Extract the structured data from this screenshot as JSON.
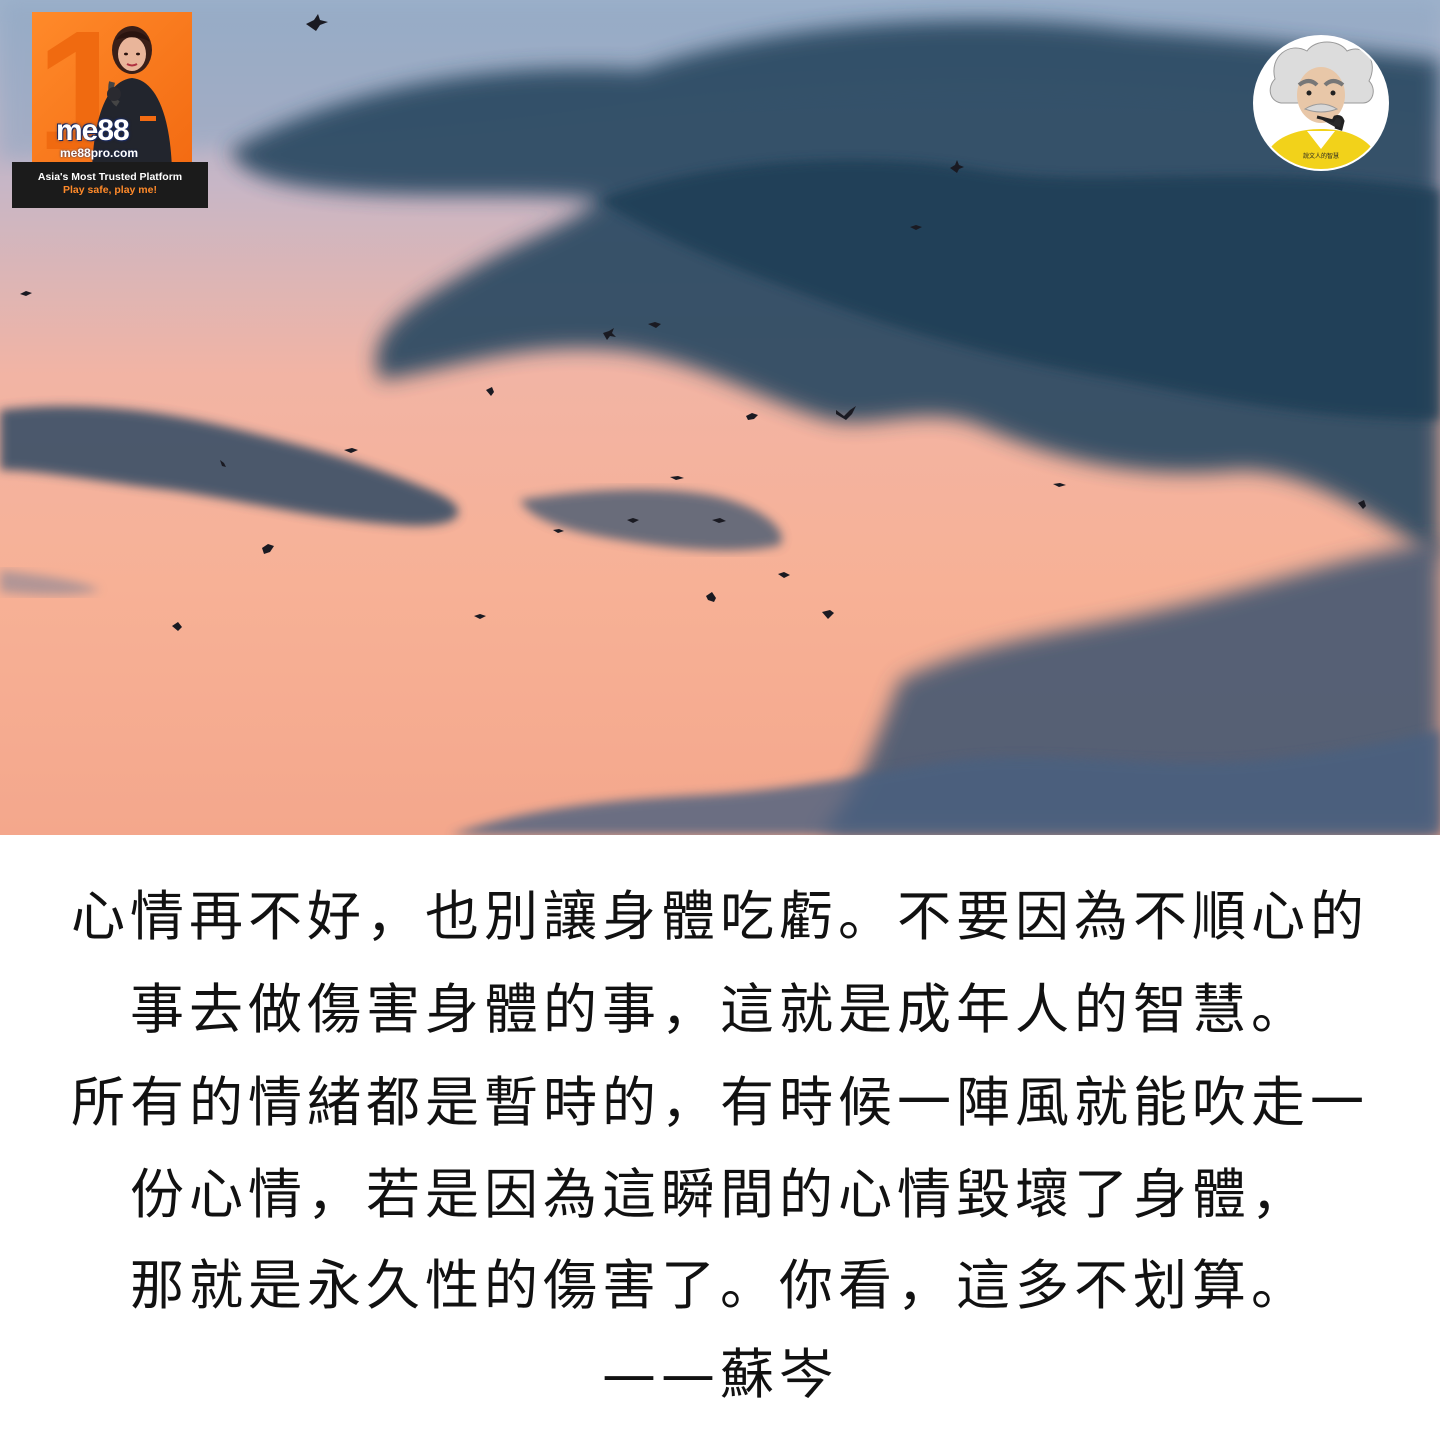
{
  "badge": {
    "digit": "1",
    "logo": "me88",
    "url": "me88pro.com",
    "tagline": "Asia's Most Trusted Platform",
    "slogan": "Play safe, play me!",
    "accent": "#f36b12"
  },
  "avatar": {
    "label": "說文人的智慧"
  },
  "quote": {
    "lines": [
      "心情再不好，也別讓身體吃虧。不要因為不順心的",
      "事去做傷害身體的事，這就是成年人的智慧。",
      "所有的情緒都是暫時的，有時候一陣風就能吹走一",
      "份心情，若是因為這瞬間的心情毀壞了身體，",
      "那就是永久性的傷害了。你看，這多不划算。",
      "——蘇岑"
    ]
  },
  "colors": {
    "sky_top": "#9fb3cc",
    "sky_bottom": "#f4a78c",
    "cloud": "#2c4a66",
    "text": "#111111"
  }
}
